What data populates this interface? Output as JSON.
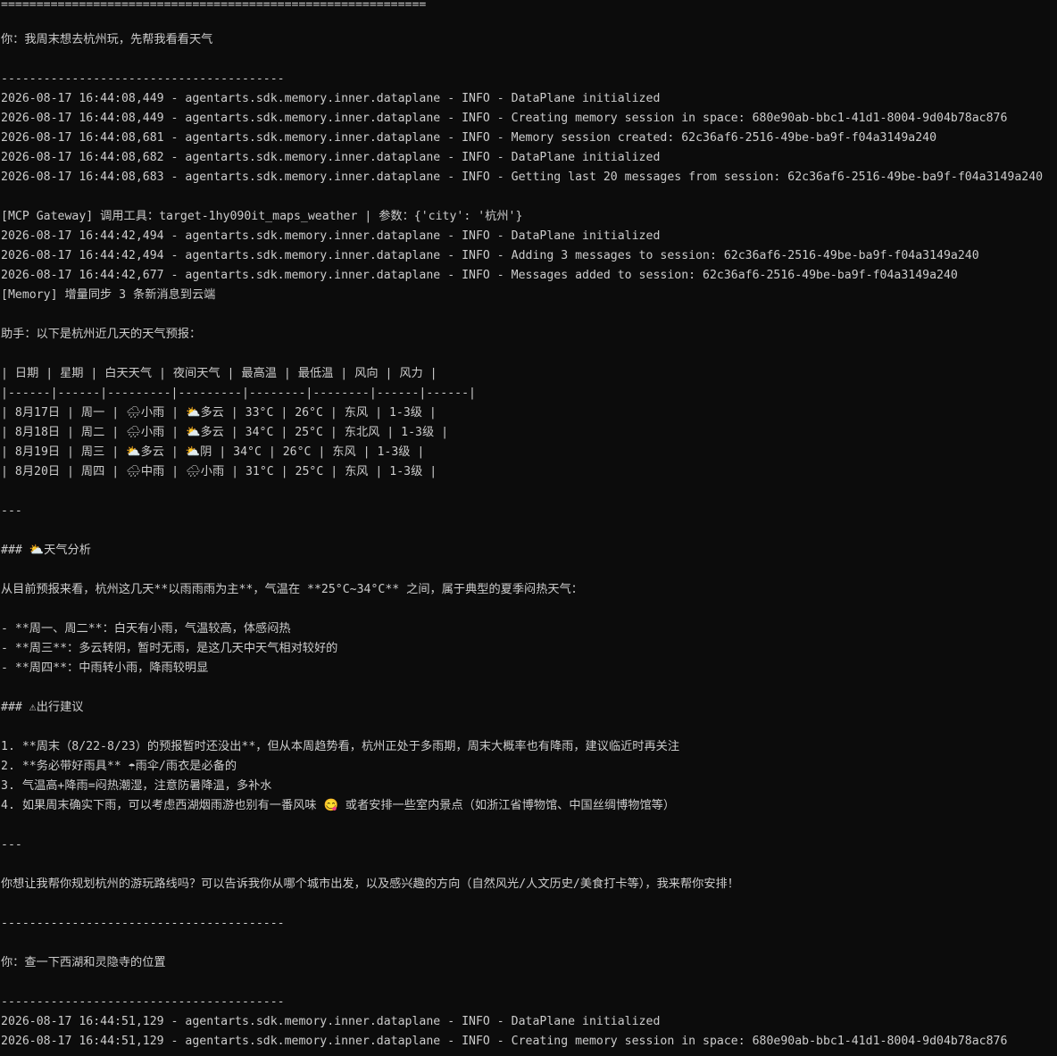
{
  "terminal": {
    "lines": [
      "============================================================",
      "",
      "你：我周末想去杭州玩，先帮我看看天气",
      "",
      "----------------------------------------",
      "2026-08-17 16:44:08,449 - agentarts.sdk.memory.inner.dataplane - INFO - DataPlane initialized",
      "2026-08-17 16:44:08,449 - agentarts.sdk.memory.inner.dataplane - INFO - Creating memory session in space: 680e90ab-bbc1-41d1-8004-9d04b78ac876",
      "2026-08-17 16:44:08,681 - agentarts.sdk.memory.inner.dataplane - INFO - Memory session created: 62c36af6-2516-49be-ba9f-f04a3149a240",
      "2026-08-17 16:44:08,682 - agentarts.sdk.memory.inner.dataplane - INFO - DataPlane initialized",
      "2026-08-17 16:44:08,683 - agentarts.sdk.memory.inner.dataplane - INFO - Getting last 20 messages from session: 62c36af6-2516-49be-ba9f-f04a3149a240",
      "",
      "[MCP Gateway] 调用工具：target-1hy090it_maps_weather | 参数：{'city': '杭州'}",
      "2026-08-17 16:44:42,494 - agentarts.sdk.memory.inner.dataplane - INFO - DataPlane initialized",
      "2026-08-17 16:44:42,494 - agentarts.sdk.memory.inner.dataplane - INFO - Adding 3 messages to session: 62c36af6-2516-49be-ba9f-f04a3149a240",
      "2026-08-17 16:44:42,677 - agentarts.sdk.memory.inner.dataplane - INFO - Messages added to session: 62c36af6-2516-49be-ba9f-f04a3149a240",
      "[Memory] 增量同步 3 条新消息到云端",
      "",
      "助手：以下是杭州近几天的天气预报：",
      "",
      "| 日期 | 星期 | 白天天气 | 夜间天气 | 最高温 | 最低温 | 风向 | 风力 |",
      "|------|------|---------|---------|--------|--------|------|------|",
      "| 8月17日 | 周一 | 🌧小雨 | ⛅多云 | 33°C | 26°C | 东风 | 1-3级 |",
      "| 8月18日 | 周二 | 🌧小雨 | ⛅多云 | 34°C | 25°C | 东北风 | 1-3级 |",
      "| 8月19日 | 周三 | ⛅多云 | ⛅阴 | 34°C | 26°C | 东风 | 1-3级 |",
      "| 8月20日 | 周四 | 🌧中雨 | 🌧小雨 | 31°C | 25°C | 东风 | 1-3级 |",
      "",
      "---",
      "",
      "### ⛅天气分析",
      "",
      "从目前预报来看，杭州这几天**以雨雨雨为主**，气温在 **25°C~34°C** 之间，属于典型的夏季闷热天气：",
      "",
      "- **周一、周二**：白天有小雨，气温较高，体感闷热",
      "- **周三**：多云转阴，暂时无雨，是这几天中天气相对较好的",
      "- **周四**：中雨转小雨，降雨较明显",
      "",
      "### ⚠出行建议",
      "",
      "1. **周末（8/22-8/23）的预报暂时还没出**，但从本周趋势看，杭州正处于多雨期，周末大概率也有降雨，建议临近时再关注",
      "2. **务必带好雨具** ☂雨伞/雨衣是必备的",
      "3. 气温高+降雨=闷热潮湿，注意防暑降温，多补水",
      "4. 如果周末确实下雨，可以考虑西湖烟雨游也别有一番风味 😋 或者安排一些室内景点（如浙江省博物馆、中国丝绸博物馆等）",
      "",
      "---",
      "",
      "你想让我帮你规划杭州的游玩路线吗？可以告诉我你从哪个城市出发，以及感兴趣的方向（自然风光/人文历史/美食打卡等），我来帮你安排！",
      "",
      "----------------------------------------",
      "",
      "你：查一下西湖和灵隐寺的位置",
      "",
      "----------------------------------------",
      "2026-08-17 16:44:51,129 - agentarts.sdk.memory.inner.dataplane - INFO - DataPlane initialized",
      "2026-08-17 16:44:51,129 - agentarts.sdk.memory.inner.dataplane - INFO - Creating memory session in space: 680e90ab-bbc1-41d1-8004-9d04b78ac876"
    ]
  }
}
